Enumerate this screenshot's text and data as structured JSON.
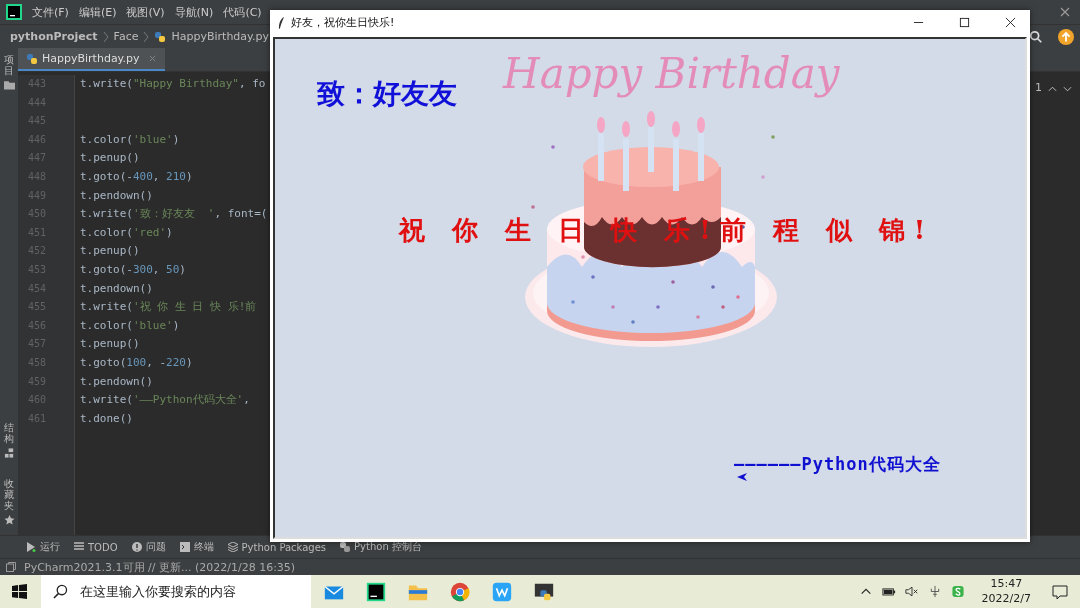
{
  "ide": {
    "menu": [
      "文件(F)",
      "编辑(E)",
      "视图(V)",
      "导航(N)",
      "代码(C)"
    ],
    "breadcrumb": [
      "pythonProject",
      "Face",
      "HappyBirthday.py"
    ],
    "tab": {
      "label": "HappyBirthday.py",
      "selected": true
    },
    "left_strip_top": "项目",
    "left_strip_bottom": [
      "结构",
      "收藏夹"
    ],
    "code_lines": [
      {
        "number": "443",
        "text": "t.write(\"Happy Birthday\", fo"
      },
      {
        "number": "444"
      },
      {
        "number": "445"
      },
      {
        "number": "446",
        "text": "t.color('blue')"
      },
      {
        "number": "447",
        "text": "t.penup()"
      },
      {
        "number": "448",
        "text": "t.goto(-400, 210)"
      },
      {
        "number": "449",
        "text": "t.pendown()"
      },
      {
        "number": "450",
        "text": "t.write('致：好友友  ', font=("
      },
      {
        "number": "451",
        "text": "t.color('red')"
      },
      {
        "number": "452",
        "text": "t.penup()"
      },
      {
        "number": "453",
        "text": "t.goto(-300, 50)"
      },
      {
        "number": "454",
        "text": "t.pendown()"
      },
      {
        "number": "455",
        "text": "t.write('祝 你 生 日 快 乐!前 "
      },
      {
        "number": "456",
        "text": "t.color('blue')"
      },
      {
        "number": "457",
        "text": "t.penup()"
      },
      {
        "number": "458",
        "text": "t.goto(100, -220)"
      },
      {
        "number": "459",
        "text": "t.pendown()"
      },
      {
        "number": "460",
        "text": "t.write('——Python代码大全', "
      },
      {
        "number": "461",
        "text": "t.done()"
      }
    ],
    "problem_count": "1",
    "tool_windows": [
      {
        "kind": "run",
        "label": "运行"
      },
      {
        "kind": "list",
        "label": "TODO"
      },
      {
        "kind": "alert",
        "label": "问题"
      },
      {
        "kind": "terminal",
        "label": "终端"
      },
      {
        "kind": "layers",
        "label": "Python Packages"
      },
      {
        "kind": "python",
        "label": "Python 控制台"
      }
    ],
    "status": "PyCharm2021.3.1可用 // 更新... (2022/1/28 16:35)"
  },
  "turtle_window": {
    "title": "好友，祝你生日快乐!",
    "canvas": {
      "heading": "Happy Birthday",
      "greeting": "致：好友友",
      "wish": "祝 你 生 日 快 乐!前 程 似 锦!",
      "signature": "——————Python代码大全"
    }
  },
  "taskbar": {
    "search": {
      "placeholder": "在这里输入你要搜索的内容"
    },
    "time": "15:47",
    "date": "2022/2/7"
  }
}
